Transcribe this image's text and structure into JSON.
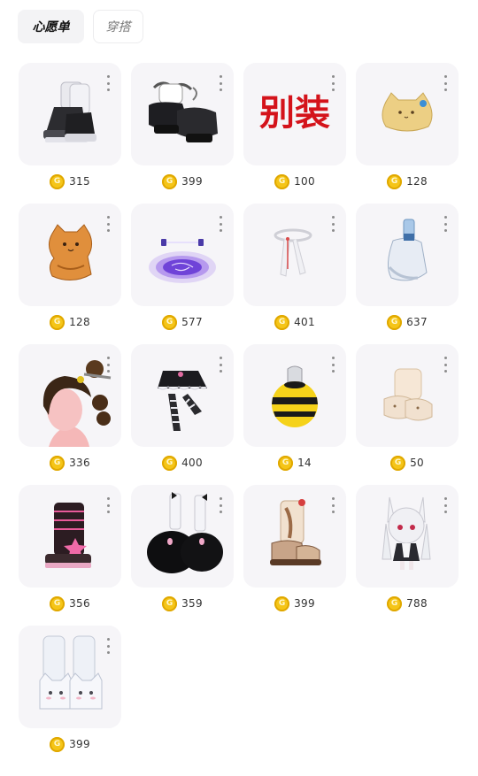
{
  "tabs": [
    {
      "label": "心愿单",
      "active": true
    },
    {
      "label": "穿搭",
      "active": false
    }
  ],
  "coin_symbol": "G",
  "items": [
    {
      "icon": "white-leg-warmer-platform-boots-icon",
      "price": "315"
    },
    {
      "icon": "black-frilly-mary-jane-shoes-icon",
      "price": "399"
    },
    {
      "icon": "red-calligraphy-sticker-icon",
      "price": "100",
      "label_text": "别装"
    },
    {
      "icon": "yellow-cat-bun-icon",
      "price": "128"
    },
    {
      "icon": "orange-cat-cookie-icon",
      "price": "128"
    },
    {
      "icon": "purple-glowing-platform-icon",
      "price": "577"
    },
    {
      "icon": "white-headband-ribbon-icon",
      "price": "401"
    },
    {
      "icon": "light-blue-sock-slippers-icon",
      "price": "637"
    },
    {
      "icon": "brown-bun-hairstyle-icon",
      "price": "336"
    },
    {
      "icon": "black-frilly-skirt-striped-socks-icon",
      "price": "400"
    },
    {
      "icon": "bee-costume-icon",
      "price": "14"
    },
    {
      "icon": "cream-fuzzy-slippers-icon",
      "price": "50"
    },
    {
      "icon": "pink-star-platform-boots-icon",
      "price": "356"
    },
    {
      "icon": "black-fur-boots-white-socks-icon",
      "price": "359"
    },
    {
      "icon": "brown-bunny-boots-icon",
      "price": "399"
    },
    {
      "icon": "white-bunny-doll-icon",
      "price": "788"
    },
    {
      "icon": "white-cat-slipper-boots-icon",
      "price": "399"
    }
  ],
  "colors": {
    "card_bg": "#f6f5f8",
    "coin": "#f5c518",
    "sticker_red": "#d4131b"
  }
}
